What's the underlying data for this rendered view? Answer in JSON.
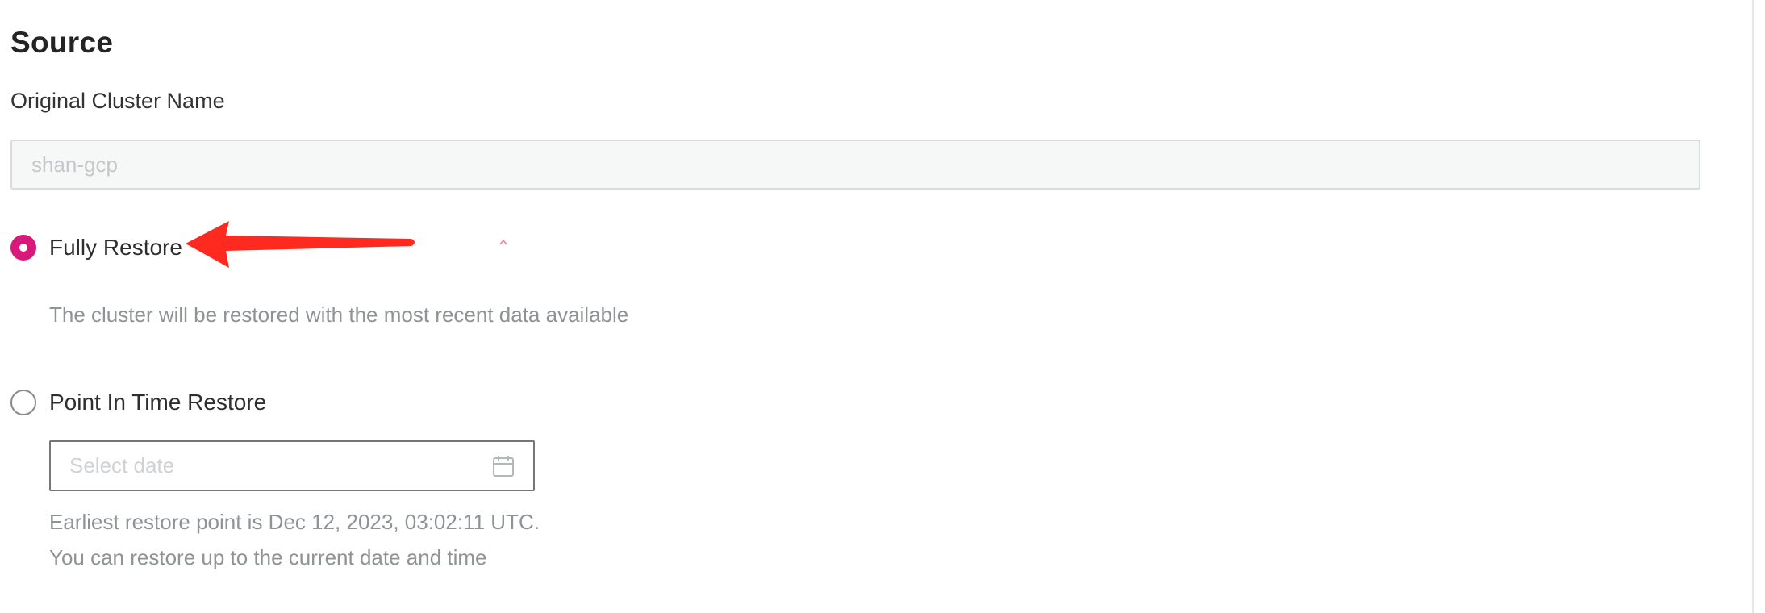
{
  "section": {
    "title": "Source"
  },
  "cluster_name": {
    "label": "Original Cluster Name",
    "placeholder": "shan-gcp",
    "value": ""
  },
  "restore_options": {
    "fully_restore": {
      "label": "Fully Restore",
      "selected": true,
      "description": "The cluster will be restored with the most recent data available"
    },
    "point_in_time": {
      "label": "Point In Time Restore",
      "selected": false,
      "date_placeholder": "Select date",
      "earliest_note": "Earliest restore point is Dec 12, 2023, 03:02:11 UTC.",
      "latest_note": "You can restore up to the current date and time"
    }
  },
  "colors": {
    "accent": "#d6197a",
    "annotation_arrow": "#ff2a1f",
    "helper_text": "#8f9396",
    "input_disabled_bg": "#f6f7f7"
  },
  "icons": {
    "date_picker": "calendar-icon",
    "annotation": "red-arrow-annotation"
  }
}
